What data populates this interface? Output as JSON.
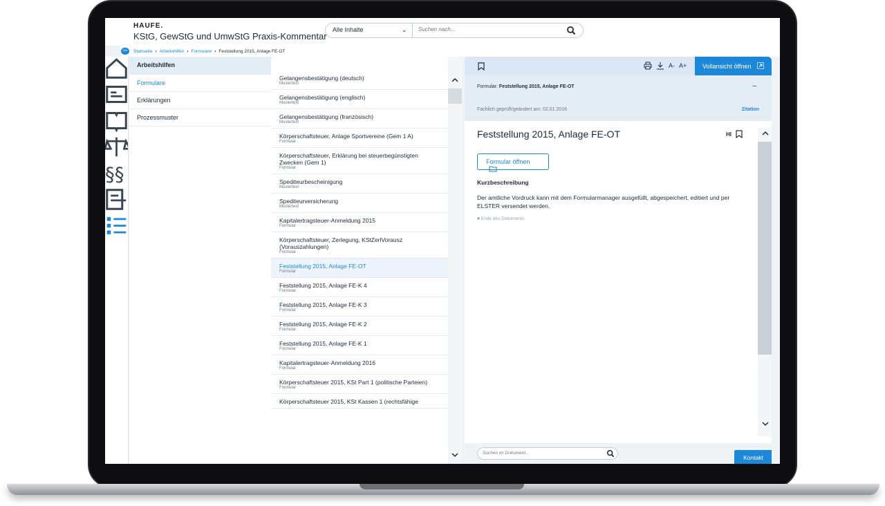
{
  "header": {
    "logo": "HAUFE.",
    "title": "KStG, GewStG und UmwStG Praxis-Kommentar",
    "search_scope": "Alle Inhalte",
    "search_placeholder": "Suchen nach..."
  },
  "breadcrumb": {
    "toggle": ">>",
    "items": [
      "Startseite",
      "Arbeitshilfen",
      "Formulare"
    ],
    "current": "Feststellung 2015, Anlage FE-OT"
  },
  "nav": {
    "heading": "Arbeitshilfen",
    "items": [
      "Formulare",
      "Erklärungen",
      "Prozessmuster"
    ]
  },
  "list": {
    "items": [
      {
        "title": "Gelangensbestätigung (deutsch)",
        "type": "Mustertext"
      },
      {
        "title": "Gelangensbestätigung (englisch)",
        "type": "Mustertext"
      },
      {
        "title": "Gelangensbestätigung (französisch)",
        "type": "Mustertext"
      },
      {
        "title": "Körperschaftsteuer, Anlage Sportvereine (Gem 1 A)",
        "type": "Formular"
      },
      {
        "title": "Körperschaftsteuer, Erklärung bei steuerbegünstigten Zwecken (Gem 1)",
        "type": "Formular"
      },
      {
        "title": "Spediteurbescheinigung",
        "type": "Mustertext"
      },
      {
        "title": "Spediteurversicherung",
        "type": "Mustertext"
      },
      {
        "title": "Kapitalertragsteuer-Anmeldung 2015",
        "type": "Formular"
      },
      {
        "title": "Körperschaftsteuer, Zerlegung, KStZerlVorausz (Vorauszahlungen)",
        "type": "Formular"
      },
      {
        "title": "Feststellung 2015, Anlage FE-OT",
        "type": "Formular"
      },
      {
        "title": "Feststellung 2015, Anlage FE-K 4",
        "type": "Formular"
      },
      {
        "title": "Feststellung 2015, Anlage FE-K 3",
        "type": "Formular"
      },
      {
        "title": "Feststellung 2015, Anlage FE-K 2",
        "type": "Formular"
      },
      {
        "title": "Feststellung 2015, Anlage FE-K 1",
        "type": "Formular"
      },
      {
        "title": "Kapitalertragsteuer-Anmeldung 2016",
        "type": "Formular"
      },
      {
        "title": "Körperschaftsteuer 2015, KSt Part 1 (politische Parteien)",
        "type": "Formular"
      },
      {
        "title": "Körperschaftsteuer 2015, KSt Kassen 1 (rechtsfähige",
        "type": ""
      }
    ]
  },
  "detail": {
    "open_full_label": "Vollansicht öffnen",
    "font_smaller": "A-",
    "font_larger": "A+",
    "meta_prefix": "Formular:",
    "meta_title": "Feststellung 2015, Anlage FE-OT",
    "collapse": "–",
    "checked_date": "Fachlich geprüft/geändert am: 02.01.2016",
    "citation": "Zitation",
    "doc_title": "Feststellung 2015, Anlage FE-OT",
    "highlight_label": "HI",
    "form_open_label": "Formular öffnen",
    "section_heading": "Kurzbeschreibung",
    "description": "Der amtliche Vordruck kann mit dem Formularmanager ausgefüllt, abgespeichert, editiert und per ELSTER versendet werden.",
    "end_note": "■  Ende des Dokuments",
    "doc_search_placeholder": "Suchen im Dokument...",
    "contact_label": "Kontakt"
  },
  "colors": {
    "accent": "#1d88d9",
    "panel": "#dbe7f4",
    "selected": "#eef4fb"
  }
}
